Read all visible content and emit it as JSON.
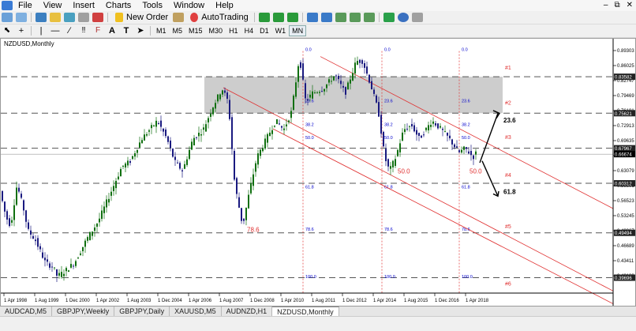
{
  "menu": [
    "File",
    "View",
    "Insert",
    "Charts",
    "Tools",
    "Window",
    "Help"
  ],
  "toolbar": {
    "new_order": "New Order",
    "autotrading": "AutoTrading"
  },
  "timeframes": [
    "M1",
    "M5",
    "M15",
    "M30",
    "H1",
    "H4",
    "D1",
    "W1",
    "MN"
  ],
  "active_timeframe": "MN",
  "chart": {
    "symbol_label": "NZDUSD,Monthly",
    "price_labels": [
      "0.89303",
      "0.86025",
      "0.82747",
      "0.79469",
      "0.76191",
      "0.72913",
      "0.69635",
      "0.66357",
      "0.63079",
      "0.59801",
      "0.56523",
      "0.53245",
      "0.49967",
      "0.46689",
      "0.43411",
      "0.40133"
    ],
    "badges": [
      {
        "text": "0.83582",
        "value": 0.83582
      },
      {
        "text": "0.75621",
        "value": 0.75621
      },
      {
        "text": "0.67967",
        "value": 0.67967
      },
      {
        "text": "0.66674",
        "value": 0.66674
      },
      {
        "text": "0.60312",
        "value": 0.60312
      },
      {
        "text": "0.49494",
        "value": 0.49494
      },
      {
        "text": "0.39696",
        "value": 0.39696
      }
    ],
    "date_labels": [
      "1 Apr 1998",
      "1 Aug 1999",
      "1 Dec 2000",
      "1 Apr 2002",
      "1 Aug 2003",
      "1 Dec 2004",
      "1 Apr 2006",
      "1 Aug 2007",
      "1 Dec 2008",
      "1 Apr 2010",
      "1 Aug 2011",
      "1 Dec 2012",
      "1 Apr 2014",
      "1 Aug 2015",
      "1 Dec 2016",
      "1 Apr 2018"
    ],
    "level_tags": [
      "#1",
      "#2",
      "#3",
      "#4",
      "#5",
      "#6"
    ],
    "fib_levels": [
      "0.0",
      "23.6",
      "38.2",
      "50.0",
      "61.8",
      "78.6",
      "100.0"
    ],
    "annotations": {
      "up_label": "23.6",
      "down_label": "61.8",
      "mid_50_a": "50.0",
      "mid_50_b": "50.0",
      "low_786": "78.6"
    }
  },
  "colors": {
    "bull": "#0f6f0f",
    "bear": "#1a1a80",
    "fib": "#0000cc",
    "channel": "#e03030",
    "zone": "#c8c8c8",
    "grid": "#555555"
  },
  "tabs": [
    "AUDCAD,M5",
    "GBPJPY,Weekly",
    "GBPJPY,Daily",
    "XAUUSD,M5",
    "AUDNZD,H1",
    "NZDUSD,Monthly"
  ],
  "active_tab": "NZDUSD,Monthly"
}
